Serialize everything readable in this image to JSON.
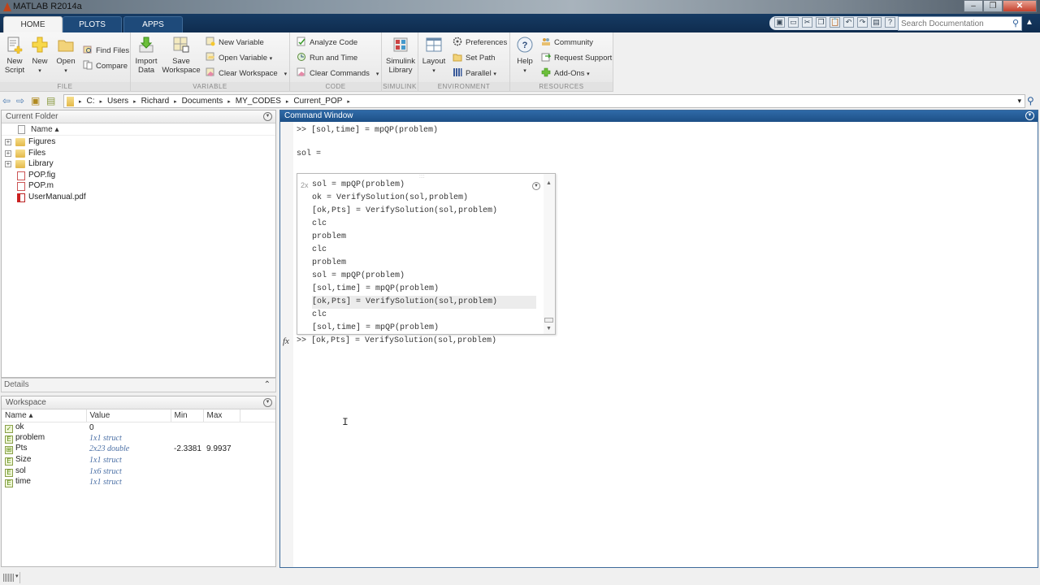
{
  "window": {
    "title": "MATLAB R2014a",
    "controls": {
      "minimize": "–",
      "maximize": "❐",
      "close": "✕"
    }
  },
  "tabs": [
    {
      "label": "HOME",
      "active": true
    },
    {
      "label": "PLOTS",
      "active": false
    },
    {
      "label": "APPS",
      "active": false
    }
  ],
  "quick_access": {
    "icons": [
      "new-script-icon",
      "save-icon",
      "cut-icon",
      "copy-icon",
      "paste-icon",
      "undo-icon",
      "redo-icon",
      "switch-windows-icon",
      "help-icon"
    ],
    "glyphs": [
      "▣",
      "▭",
      "✂",
      "❐",
      "📋",
      "↶",
      "↷",
      "▤",
      "?"
    ]
  },
  "search": {
    "placeholder": "Search Documentation",
    "icon": "⚲"
  },
  "ribbon": {
    "sections": {
      "file": "FILE",
      "variable": "VARIABLE",
      "code": "CODE",
      "simulink": "SIMULINK",
      "environment": "ENVIRONMENT",
      "resources": "RESOURCES"
    },
    "file": {
      "new_script": [
        "New",
        "Script"
      ],
      "new": "New",
      "open": "Open",
      "find_files": "Find Files",
      "compare": "Compare"
    },
    "variable": {
      "import_data": [
        "Import",
        "Data"
      ],
      "save_workspace": [
        "Save",
        "Workspace"
      ],
      "new_variable": "New Variable",
      "open_variable": "Open Variable",
      "clear_workspace": "Clear Workspace"
    },
    "code": {
      "analyze_code": "Analyze Code",
      "run_and_time": "Run and Time",
      "clear_commands": "Clear Commands"
    },
    "simulink": {
      "simulink_library": [
        "Simulink",
        "Library"
      ]
    },
    "environment": {
      "layout": "Layout",
      "preferences": "Preferences",
      "set_path": "Set Path",
      "parallel": "Parallel"
    },
    "resources": {
      "help": "Help",
      "community": "Community",
      "request_support": "Request Support",
      "add_ons": "Add-Ons"
    },
    "caret": "▾"
  },
  "address_bar": {
    "crumbs": [
      "C:",
      "Users",
      "Richard",
      "Documents",
      "MY_CODES",
      "Current_POP"
    ],
    "separator": "▸",
    "dropdown": "▾",
    "search_icon": "⚲"
  },
  "current_folder": {
    "title": "Current Folder",
    "column": "Name ▴",
    "items": [
      {
        "name": "Figures",
        "type": "folder",
        "expandable": true
      },
      {
        "name": "Files",
        "type": "folder",
        "expandable": true
      },
      {
        "name": "Library",
        "type": "folder",
        "expandable": true
      },
      {
        "name": "POP.fig",
        "type": "fig",
        "expandable": false
      },
      {
        "name": "POP.m",
        "type": "m",
        "expandable": false
      },
      {
        "name": "UserManual.pdf",
        "type": "pdf",
        "expandable": false
      }
    ],
    "expander": "+"
  },
  "details": {
    "title": "Details",
    "toggle": "⌃"
  },
  "workspace": {
    "title": "Workspace",
    "columns": [
      "Name ▴",
      "Value",
      "Min",
      "Max"
    ],
    "rows": [
      {
        "name": "ok",
        "value": "0",
        "min": "",
        "max": "",
        "icon": "✓",
        "italic": false
      },
      {
        "name": "problem",
        "value": "1x1 struct",
        "min": "",
        "max": "",
        "icon": "E",
        "italic": true
      },
      {
        "name": "Pts",
        "value": "2x23 double",
        "min": "-2.3381",
        "max": "9.9937",
        "icon": "⊞",
        "italic": true
      },
      {
        "name": "Size",
        "value": "1x1 struct",
        "min": "",
        "max": "",
        "icon": "E",
        "italic": true
      },
      {
        "name": "sol",
        "value": "1x6 struct",
        "min": "",
        "max": "",
        "icon": "E",
        "italic": true
      },
      {
        "name": "time",
        "value": "1x1 struct",
        "min": "",
        "max": "",
        "icon": "E",
        "italic": true
      }
    ]
  },
  "command_window": {
    "title": "Command Window",
    "lines": [
      ">> [sol,time] = mpQP(problem)",
      "sol ="
    ],
    "history_popup": {
      "count": "2x",
      "grip": "::::",
      "items": [
        "sol = mpQP(problem)",
        "ok = VerifySolution(sol,problem)",
        "[ok,Pts] = VerifySolution(sol,problem)",
        "clc",
        "problem",
        "clc",
        "problem",
        "sol = mpQP(problem)",
        "[sol,time] = mpQP(problem)",
        "[ok,Pts] = VerifySolution(sol,problem)",
        "clc",
        "[sol,time] = mpQP(problem)"
      ],
      "selected_index": 9
    },
    "fx_label": "fx",
    "current_input": ">> [ok,Pts] = VerifySolution(sol,problem)",
    "ibeam": "I"
  },
  "statusbar": {
    "caret": "▾"
  }
}
